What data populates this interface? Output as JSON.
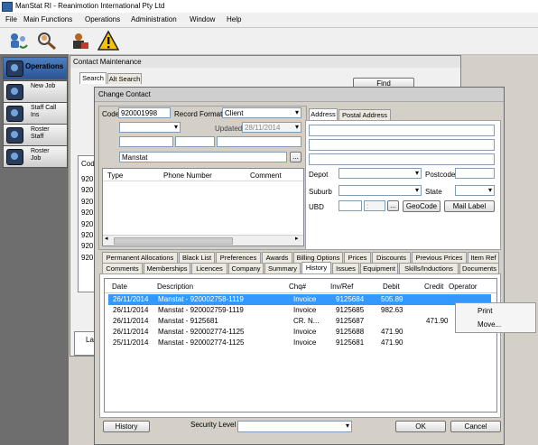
{
  "app": {
    "title": "ManStat RI - Reanimotion International Pty Ltd"
  },
  "menu": [
    "File",
    "Main Functions",
    "Operations",
    "Administration",
    "Window",
    "Help"
  ],
  "toolbar_icons": [
    "people-refresh-icon",
    "search-person-icon",
    "contact-card-icon",
    "warning-icon"
  ],
  "sidebar": {
    "items": [
      {
        "label": "Operations",
        "active": true
      },
      {
        "label": "New Job"
      },
      {
        "label": "Staff Call Ins"
      },
      {
        "label": "Roster Staff"
      },
      {
        "label": "Roster Job"
      }
    ]
  },
  "contact_maintenance": {
    "title": "Contact Maintenance",
    "tabs": [
      "Search",
      "Alt Search"
    ],
    "find_label": "Find",
    "grid_header": "Cod",
    "codes": [
      "920",
      "920",
      "920",
      "920",
      "920",
      "920",
      "920",
      "920"
    ],
    "bottom_label": "Las"
  },
  "dialog": {
    "title": "Change Contact",
    "code_label": "Code",
    "code_value": "920001998",
    "record_format_label": "Record Format",
    "record_format_value": "Client",
    "updated_label": "Updated",
    "updated_value": "28/11/2014",
    "name_value": "Manstat",
    "browse_label": "...",
    "phone_headers": [
      "Type",
      "Phone Number",
      "Comment"
    ],
    "address_tabs": [
      "Address",
      "Postal Address"
    ],
    "depot_label": "Depot",
    "postcode_label": "Postcode",
    "suburb_label": "Suburb",
    "state_label": "State",
    "ubd_label": "UBD",
    "ubd_sep": ":",
    "geocode_label": "GeoCode",
    "mail_label": "Mail Label",
    "tabs_row1": [
      "Permanent Allocations",
      "Black List",
      "Preferences",
      "Awards",
      "Billing Options",
      "Prices",
      "Discounts",
      "Previous Prices",
      "Item Ref"
    ],
    "tabs_row2": [
      "Comments",
      "Memberships",
      "Licences",
      "Company",
      "Summary",
      "History",
      "Issues",
      "Equipment",
      "Skills/Inductions",
      "Documents"
    ],
    "selected_tab": "History",
    "history_headers": [
      "Date",
      "Description",
      "Chq#",
      "Inv/Ref",
      "Debit",
      "Credit",
      "Operator"
    ],
    "history_rows": [
      {
        "date": "26/11/2014",
        "description": "Manstat - 920002758-1119",
        "chq": "Invoice",
        "ref": "9125684",
        "debit": "505.89",
        "credit": "",
        "selected": true
      },
      {
        "date": "26/11/2014",
        "description": "Manstat - 920002759-1119",
        "chq": "Invoice",
        "ref": "9125685",
        "debit": "982.63",
        "credit": ""
      },
      {
        "date": "26/11/2014",
        "description": "Manstat - 9125681",
        "chq": "CR. N...",
        "ref": "9125687",
        "debit": "",
        "credit": "471.90"
      },
      {
        "date": "26/11/2014",
        "description": "Manstat - 920002774-1125",
        "chq": "Invoice",
        "ref": "9125688",
        "debit": "471.90",
        "credit": ""
      },
      {
        "date": "25/11/2014",
        "description": "Manstat - 920002774-1125",
        "chq": "Invoice",
        "ref": "9125681",
        "debit": "471.90",
        "credit": ""
      }
    ],
    "context_menu": [
      "Print",
      "Move..."
    ],
    "history_button": "History",
    "security_level_label": "Security Level",
    "ok_label": "OK",
    "cancel_label": "Cancel"
  }
}
